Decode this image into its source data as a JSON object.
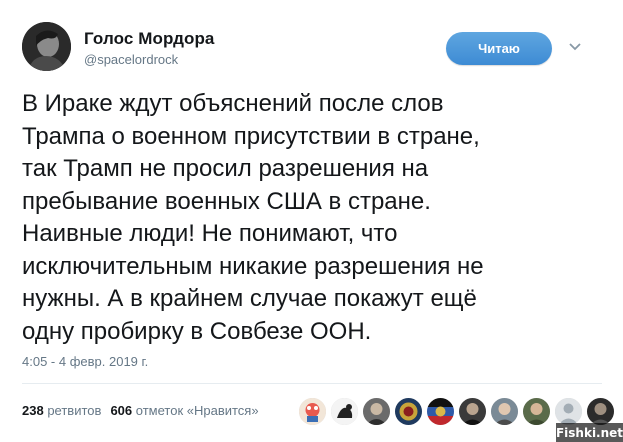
{
  "author": {
    "name": "Голос Мордора",
    "handle": "@spacelordrock"
  },
  "follow_button": {
    "label": "Читаю",
    "color": "#4a97d9"
  },
  "tweet": {
    "lines": [
      "В Ираке ждут объяснений после слов",
      "Трампа о военном присутствии в стране,",
      "так Трамп не просил разрешения на",
      "пребывание военных США в стране.",
      "Наивные люди! Не понимают, что",
      "исключительным никакие разрешения не",
      "нужны. А в крайнем случае покажут ещё",
      "одну пробирку в Совбезе ООН."
    ],
    "timestamp": "4:05 - 4 февр. 2019 г."
  },
  "stats": {
    "retweets_count": "238",
    "retweets_label": "ретвитов",
    "likes_count": "606",
    "likes_label": "отметок «Нравится»"
  },
  "likers": [
    "liker-avatar-1",
    "liker-avatar-2",
    "liker-avatar-3",
    "liker-avatar-4",
    "liker-avatar-5",
    "liker-avatar-6",
    "liker-avatar-7",
    "liker-avatar-8",
    "liker-avatar-9",
    "liker-avatar-10"
  ],
  "watermark": {
    "text": "Fishki.net"
  },
  "colors": {
    "text": "#14171a",
    "muted": "#657786",
    "divider": "#e6ecf0"
  }
}
